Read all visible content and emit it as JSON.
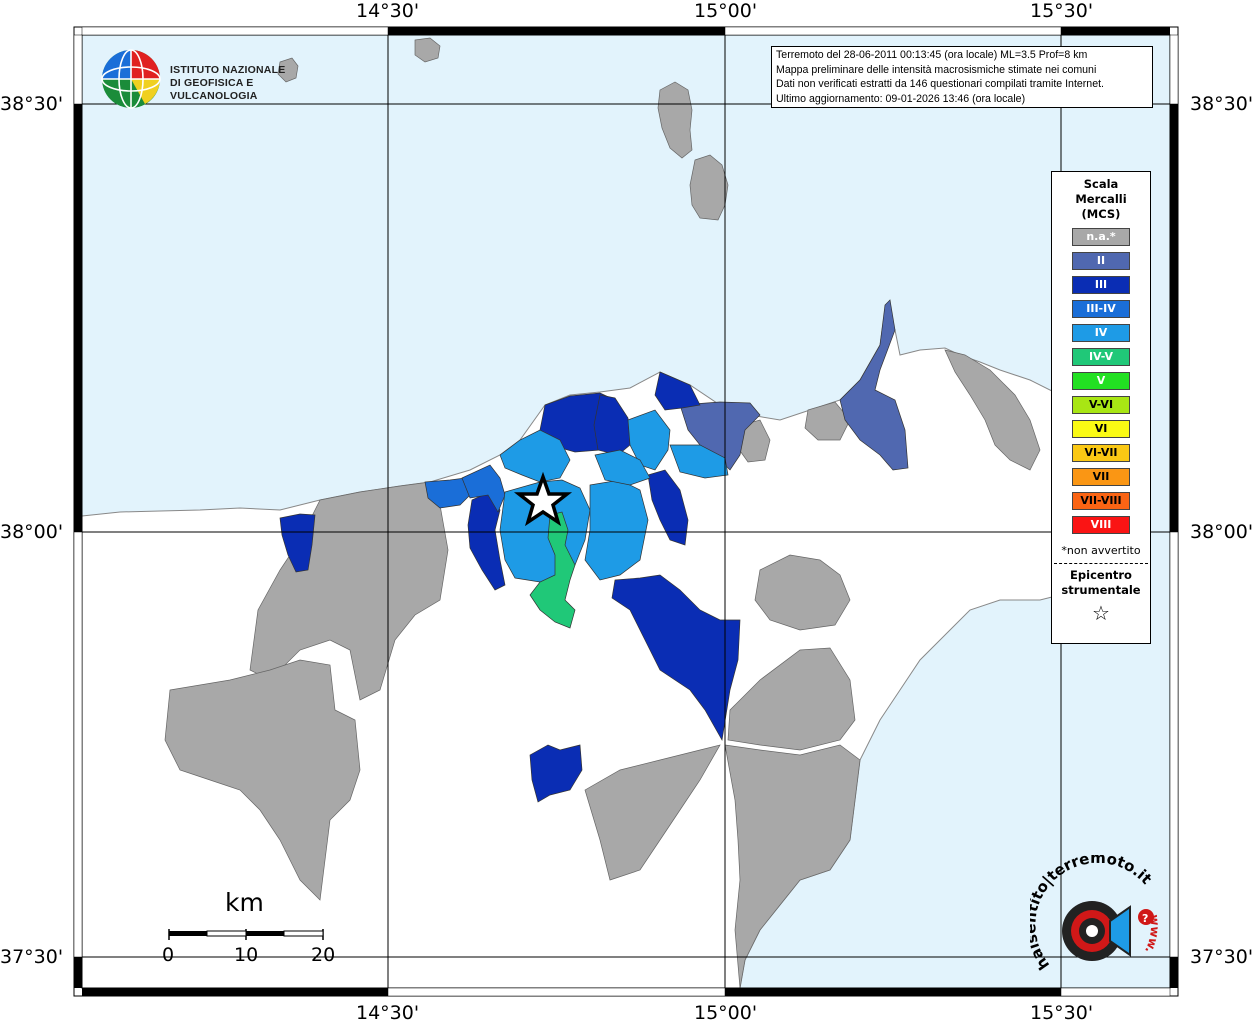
{
  "map": {
    "lon_labels": [
      "14°30'",
      "15°00'",
      "15°30'"
    ],
    "lat_labels": [
      "38°30'",
      "38°00'",
      "37°30'"
    ],
    "colors": {
      "sea": "#e2f3fc",
      "land": "#ffffff",
      "na": "#a8a8a8",
      "II": "#5068b0",
      "III": "#0a2db4",
      "III-IV": "#1a6ed8",
      "IV": "#1e9be6",
      "IV-V": "#20c878"
    }
  },
  "institute": {
    "line1": "ISTITUTO NAZIONALE",
    "line2": "DI GEOFISICA E VULCANOLOGIA"
  },
  "info": {
    "line1": "Terremoto del 28-06-2011 00:13:45 (ora locale) ML=3.5 Prof=8 km",
    "line2": "Mappa preliminare delle intensità macrosismiche stimate nei comuni",
    "line3": "Dati non verificati estratti da 146 questionari compilati tramite Internet.",
    "line4": "Ultimo aggiornamento: 09-01-2026 13:46 (ora locale)"
  },
  "legend": {
    "title_1": "Scala",
    "title_2": "Mercalli",
    "title_3": "(MCS)",
    "items": [
      {
        "label": "n.a.*",
        "color": "#a8a8a8"
      },
      {
        "label": "II",
        "color": "#5068b0"
      },
      {
        "label": "III",
        "color": "#0a2db4"
      },
      {
        "label": "III-IV",
        "color": "#1a6ed8"
      },
      {
        "label": "IV",
        "color": "#1e9be6"
      },
      {
        "label": "IV-V",
        "color": "#20c878"
      },
      {
        "label": "V",
        "color": "#22e022"
      },
      {
        "label": "V-VI",
        "color": "#a8e614"
      },
      {
        "label": "VI",
        "color": "#fafa14"
      },
      {
        "label": "VI-VII",
        "color": "#fac814"
      },
      {
        "label": "VII",
        "color": "#fa9614"
      },
      {
        "label": "VII-VIII",
        "color": "#fa6414"
      },
      {
        "label": "VIII",
        "color": "#fa1414"
      }
    ],
    "na_note": "*non avvertito",
    "epicentro_1": "Epicentro",
    "epicentro_2": "strumentale",
    "star_glyph": "☆"
  },
  "scale_bar": {
    "unit": "km",
    "labels": [
      "0",
      "10",
      "20"
    ]
  },
  "site_logo": {
    "text": "haisentito|terremoto.it",
    "prefix": "www."
  }
}
